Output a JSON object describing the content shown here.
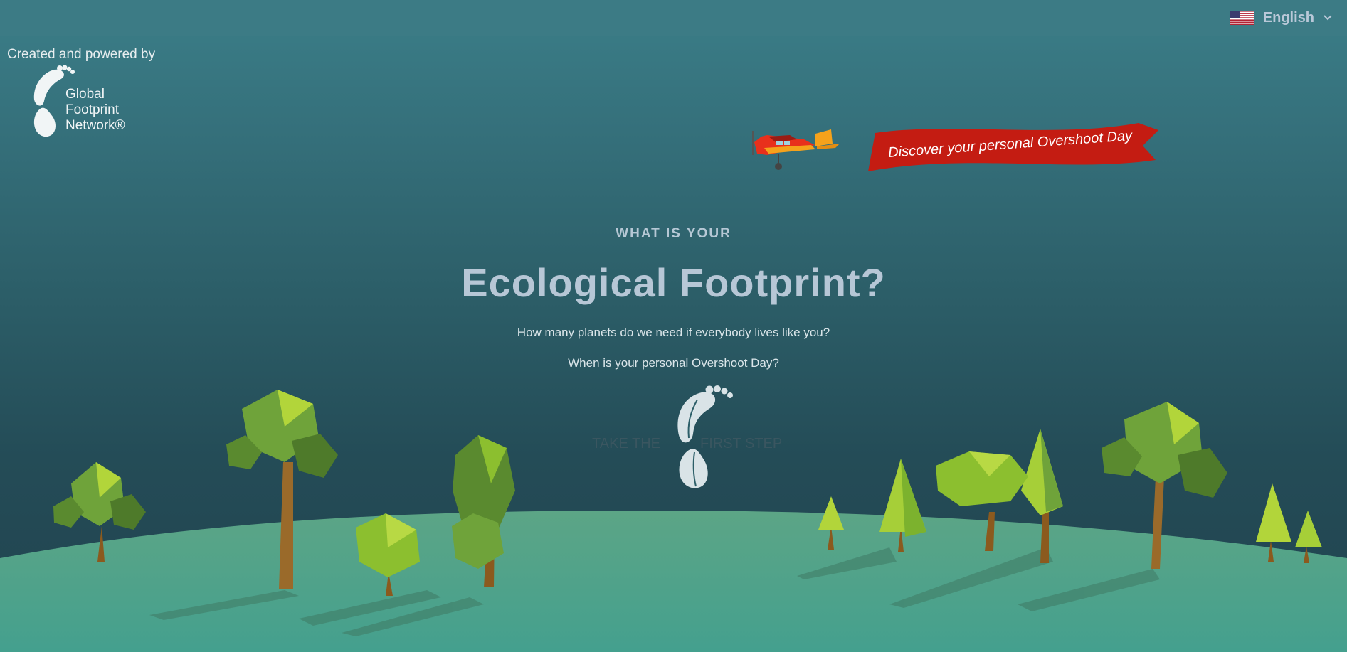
{
  "header": {
    "language_label": "English",
    "language_icon": "us-flag-icon",
    "chevron_icon": "chevron-down-icon"
  },
  "credit": {
    "text": "Created and powered by",
    "logo_lines": [
      "Global",
      "Footprint",
      "Network®"
    ]
  },
  "banner": {
    "text": "Discover your personal Overshoot Day"
  },
  "hero": {
    "eyebrow": "WHAT IS YOUR",
    "title": "Ecological Footprint?",
    "question1": "How many planets do we need if everybody lives like you?",
    "question2": "When is your personal Overshoot Day?"
  },
  "cta": {
    "left": "TAKE THE",
    "right": "FIRST STEP"
  },
  "colors": {
    "banner_red": "#c41c12",
    "hill_green": "#52a286",
    "tree_green": "#8cbf2f",
    "plane_orange": "#f19a1b"
  }
}
